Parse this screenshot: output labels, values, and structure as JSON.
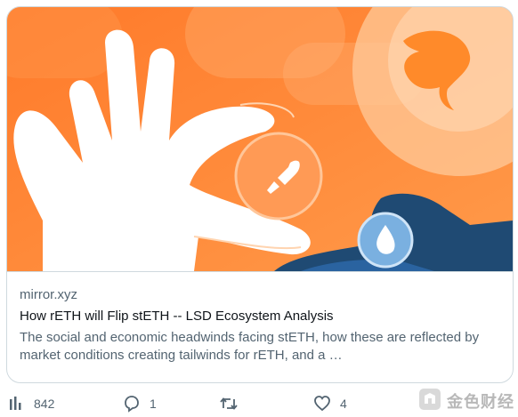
{
  "link_card": {
    "image_alt": "illustration",
    "domain": "mirror.xyz",
    "title": "How rETH will Flip stETH -- LSD Ecosystem Analysis",
    "description": "The social and economic headwinds facing stETH, how these are reflected by market conditions creating tailwinds for rETH, and a …"
  },
  "actions": {
    "views": {
      "icon": "bar-chart-icon",
      "count": "842"
    },
    "reply": {
      "icon": "speech-bubble-icon",
      "count": "1"
    },
    "retweet": {
      "icon": "retweet-icon",
      "count": ""
    },
    "like": {
      "icon": "heart-icon",
      "count": "4"
    }
  },
  "watermark": {
    "text": "金色财经"
  },
  "colors": {
    "orange_bg": "#ff8a3d",
    "orange_light": "#ffc38e",
    "hand_white": "#ffffff",
    "navy": "#1f4a73",
    "muted_text": "#536471",
    "border": "#cfd9de"
  }
}
